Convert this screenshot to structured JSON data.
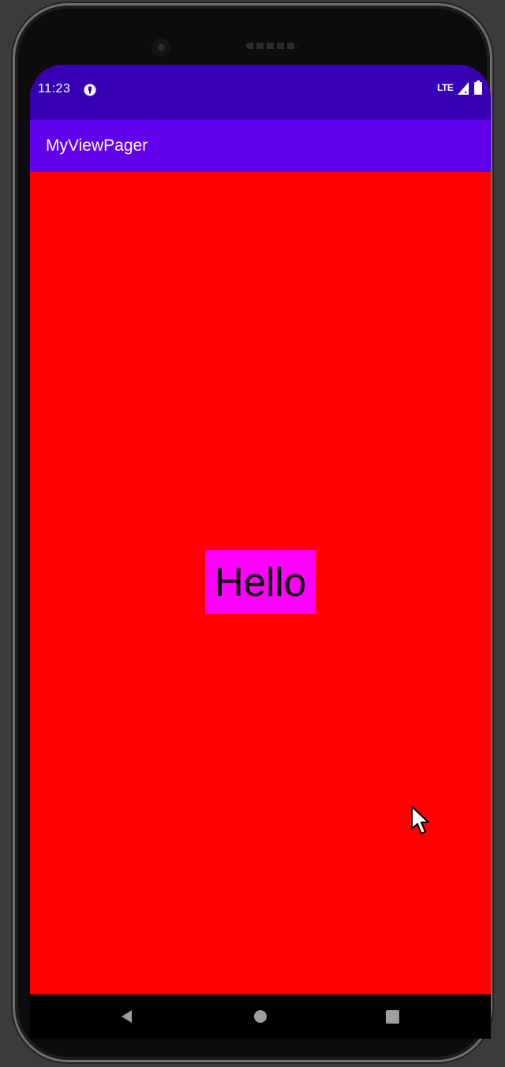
{
  "status_bar": {
    "time": "11:23",
    "network": "LTE",
    "icons": [
      "notification-icon",
      "signal-icon",
      "battery-icon"
    ],
    "background": "#3700b3"
  },
  "app_bar": {
    "title": "MyViewPager",
    "background": "#6200ee"
  },
  "content": {
    "background": "#ff0000",
    "text": "Hello",
    "text_background": "#ff00ff"
  },
  "nav_bar": {
    "icons": [
      "back-icon",
      "home-icon",
      "recents-icon"
    ]
  }
}
